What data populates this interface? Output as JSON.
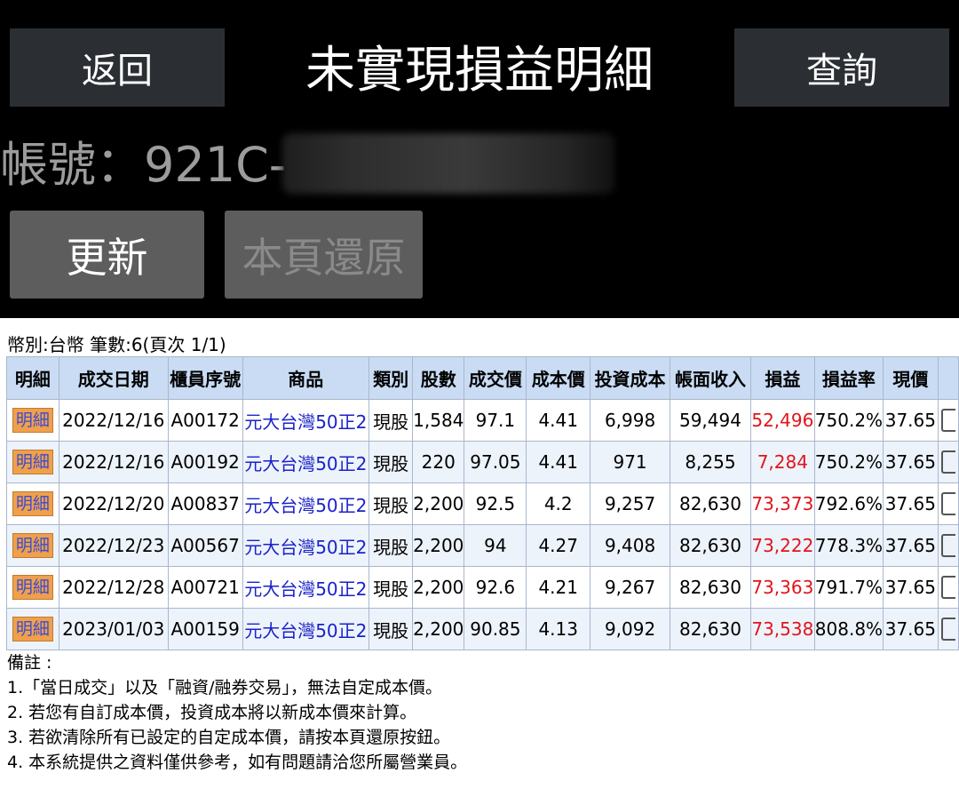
{
  "header": {
    "back_label": "返回",
    "title": "未實現損益明細",
    "query_label": "查詢",
    "account_label": "帳號：921C-0",
    "refresh_label": "更新",
    "restore_label": "本頁還原"
  },
  "summary": "幣別:台幣 筆數:6(頁次 1/1)",
  "table": {
    "headers": [
      "明細",
      "成交日期",
      "櫃員序號",
      "商品",
      "類別",
      "股數",
      "成交價",
      "成本價",
      "投資成本",
      "帳面收入",
      "損益",
      "損益率",
      "現價"
    ],
    "rows": [
      {
        "detail": "明細",
        "date": "2022/12/16",
        "serial": "A00172",
        "product": "元大台灣50正2",
        "type": "現股",
        "shares": "1,584",
        "price": "97.1",
        "cost_price": "4.41",
        "invest": "6,998",
        "income": "59,494",
        "pl": "52,496",
        "rate": "750.2%",
        "current": "37.65"
      },
      {
        "detail": "明細",
        "date": "2022/12/16",
        "serial": "A00192",
        "product": "元大台灣50正2",
        "type": "現股",
        "shares": "220",
        "price": "97.05",
        "cost_price": "4.41",
        "invest": "971",
        "income": "8,255",
        "pl": "7,284",
        "rate": "750.2%",
        "current": "37.65"
      },
      {
        "detail": "明細",
        "date": "2022/12/20",
        "serial": "A00837",
        "product": "元大台灣50正2",
        "type": "現股",
        "shares": "2,200",
        "price": "92.5",
        "cost_price": "4.2",
        "invest": "9,257",
        "income": "82,630",
        "pl": "73,373",
        "rate": "792.6%",
        "current": "37.65"
      },
      {
        "detail": "明細",
        "date": "2022/12/23",
        "serial": "A00567",
        "product": "元大台灣50正2",
        "type": "現股",
        "shares": "2,200",
        "price": "94",
        "cost_price": "4.27",
        "invest": "9,408",
        "income": "82,630",
        "pl": "73,222",
        "rate": "778.3%",
        "current": "37.65"
      },
      {
        "detail": "明細",
        "date": "2022/12/28",
        "serial": "A00721",
        "product": "元大台灣50正2",
        "type": "現股",
        "shares": "2,200",
        "price": "92.6",
        "cost_price": "4.21",
        "invest": "9,267",
        "income": "82,630",
        "pl": "73,363",
        "rate": "791.7%",
        "current": "37.65"
      },
      {
        "detail": "明細",
        "date": "2023/01/03",
        "serial": "A00159",
        "product": "元大台灣50正2",
        "type": "現股",
        "shares": "2,200",
        "price": "90.85",
        "cost_price": "4.13",
        "invest": "9,092",
        "income": "82,630",
        "pl": "73,538",
        "rate": "808.8%",
        "current": "37.65"
      }
    ]
  },
  "notes": [
    "備註 :",
    "1.「當日成交」以及「融資/融券交易」，無法自定成本價。",
    "2. 若您有自訂成本價，投資成本將以新成本價來計算。",
    "3. 若欲清除所有已設定的自定成本價，請按本頁還原按鈕。",
    "4. 本系統提供之資料僅供參考，如有問題請洽您所屬營業員。"
  ],
  "colors": {
    "profit": "#e0141b",
    "product_link": "#1a22c8",
    "header_bg": "#c9dcf4",
    "detail_btn": "#f0a04b"
  }
}
